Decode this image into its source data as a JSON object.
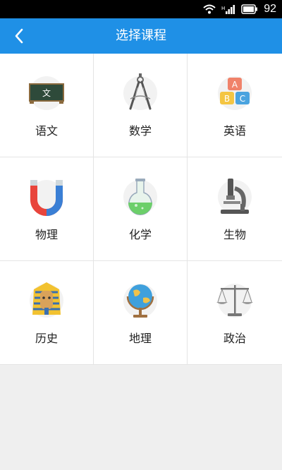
{
  "status_bar": {
    "battery_level": "92"
  },
  "header": {
    "title": "选择课程"
  },
  "courses": [
    {
      "label": "语文",
      "icon": "chalkboard-icon"
    },
    {
      "label": "数学",
      "icon": "compass-icon"
    },
    {
      "label": "英语",
      "icon": "abc-blocks-icon"
    },
    {
      "label": "物理",
      "icon": "magnet-icon"
    },
    {
      "label": "化学",
      "icon": "flask-icon"
    },
    {
      "label": "生物",
      "icon": "microscope-icon"
    },
    {
      "label": "历史",
      "icon": "pharaoh-icon"
    },
    {
      "label": "地理",
      "icon": "globe-icon"
    },
    {
      "label": "政治",
      "icon": "scales-icon"
    }
  ],
  "colors": {
    "header": "#1f90e6",
    "background": "#efefef"
  }
}
